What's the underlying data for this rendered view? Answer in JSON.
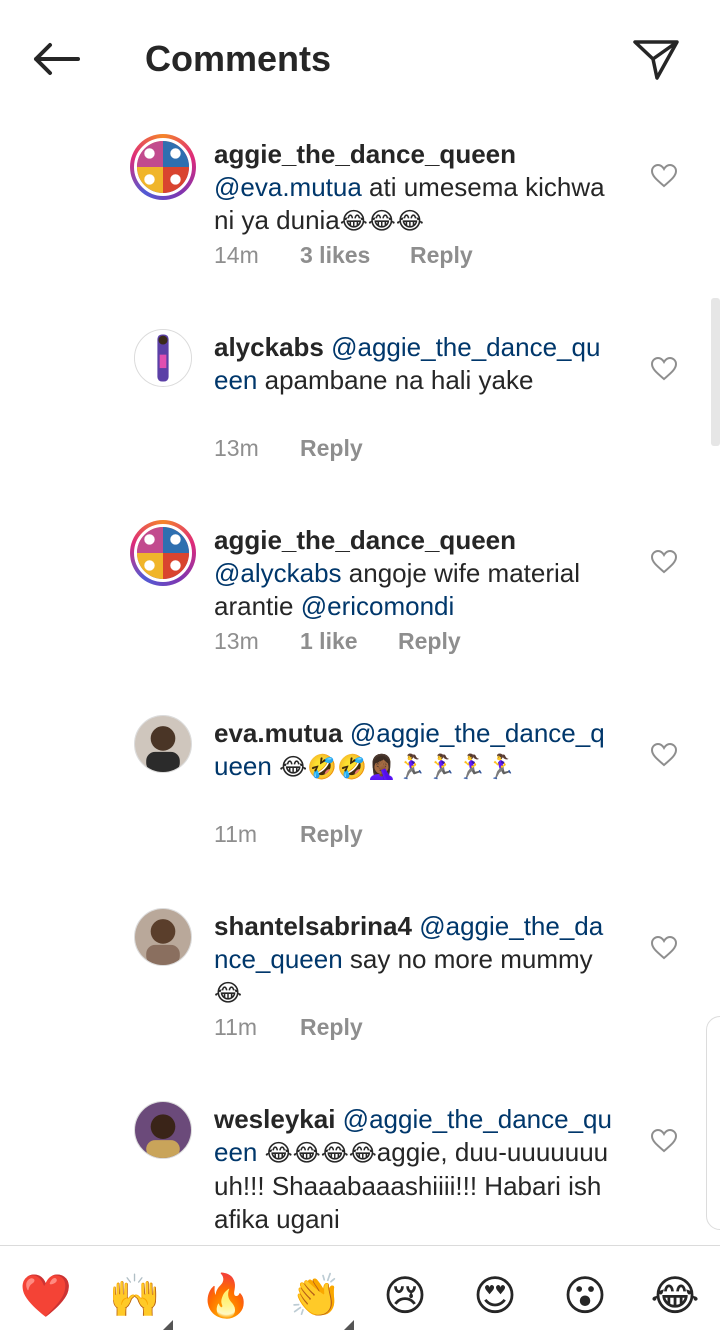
{
  "header": {
    "title": "Comments",
    "back_icon": "arrow-left-icon",
    "send_icon": "paper-plane-icon"
  },
  "comments": [
    {
      "username": "aggie_the_dance_queen",
      "mention": "@eva.mutua",
      "text_before": "",
      "text": " ati umesema kichwa ni ya dunia",
      "emojis": "😂😂😂",
      "time": "14m",
      "likes": "3 likes",
      "reply": "Reply",
      "avatar": "collage-avatar"
    },
    {
      "username": "alyckabs",
      "mention": "@aggie_the_dance_queen",
      "text_before": "",
      "text": " apambane na hali yake",
      "emojis": "",
      "time": "13m",
      "likes": "",
      "reply": "Reply",
      "avatar": "figure-avatar"
    },
    {
      "username": "aggie_the_dance_queen",
      "mention": "@alyckabs",
      "text_before": "",
      "text": " angoje wife material arantie ",
      "mention2": "@ericomondi",
      "emojis": "",
      "time": "13m",
      "likes": "1 like",
      "reply": "Reply",
      "avatar": "collage-avatar"
    },
    {
      "username": "eva.mutua",
      "mention": "@aggie_the_dance_queen",
      "text": " ",
      "emojis": "😂🤣🤣🤦🏾‍♀️🏃‍♀️🏃‍♀️🏃‍♀️🏃‍♀️",
      "time": "11m",
      "likes": "",
      "reply": "Reply",
      "avatar": "photo-avatar"
    },
    {
      "username": "shantelsabrina4",
      "mention": "@aggie_the_dance_queen",
      "text": " say no more mummy",
      "emojis": "😂",
      "time": "11m",
      "likes": "",
      "reply": "Reply",
      "avatar": "photo-avatar"
    },
    {
      "username": "wesleykai",
      "mention": "@aggie_the_dance_queen",
      "text": " ",
      "emojis": "😂😂😂😂",
      "text_after": "aggie, duu-uuuuuuuuh!!! Shaaabaaashiiii!!! Habari ishafika ugani",
      "time": "",
      "likes": "",
      "reply": "",
      "avatar": "photo-avatar"
    }
  ],
  "reactions": [
    "❤️",
    "🙌",
    "🔥",
    "👏",
    "😢",
    "😍",
    "😮",
    "😂"
  ],
  "colors": {
    "mention": "#00376b",
    "meta": "#8e8e8e",
    "text": "#262626"
  }
}
